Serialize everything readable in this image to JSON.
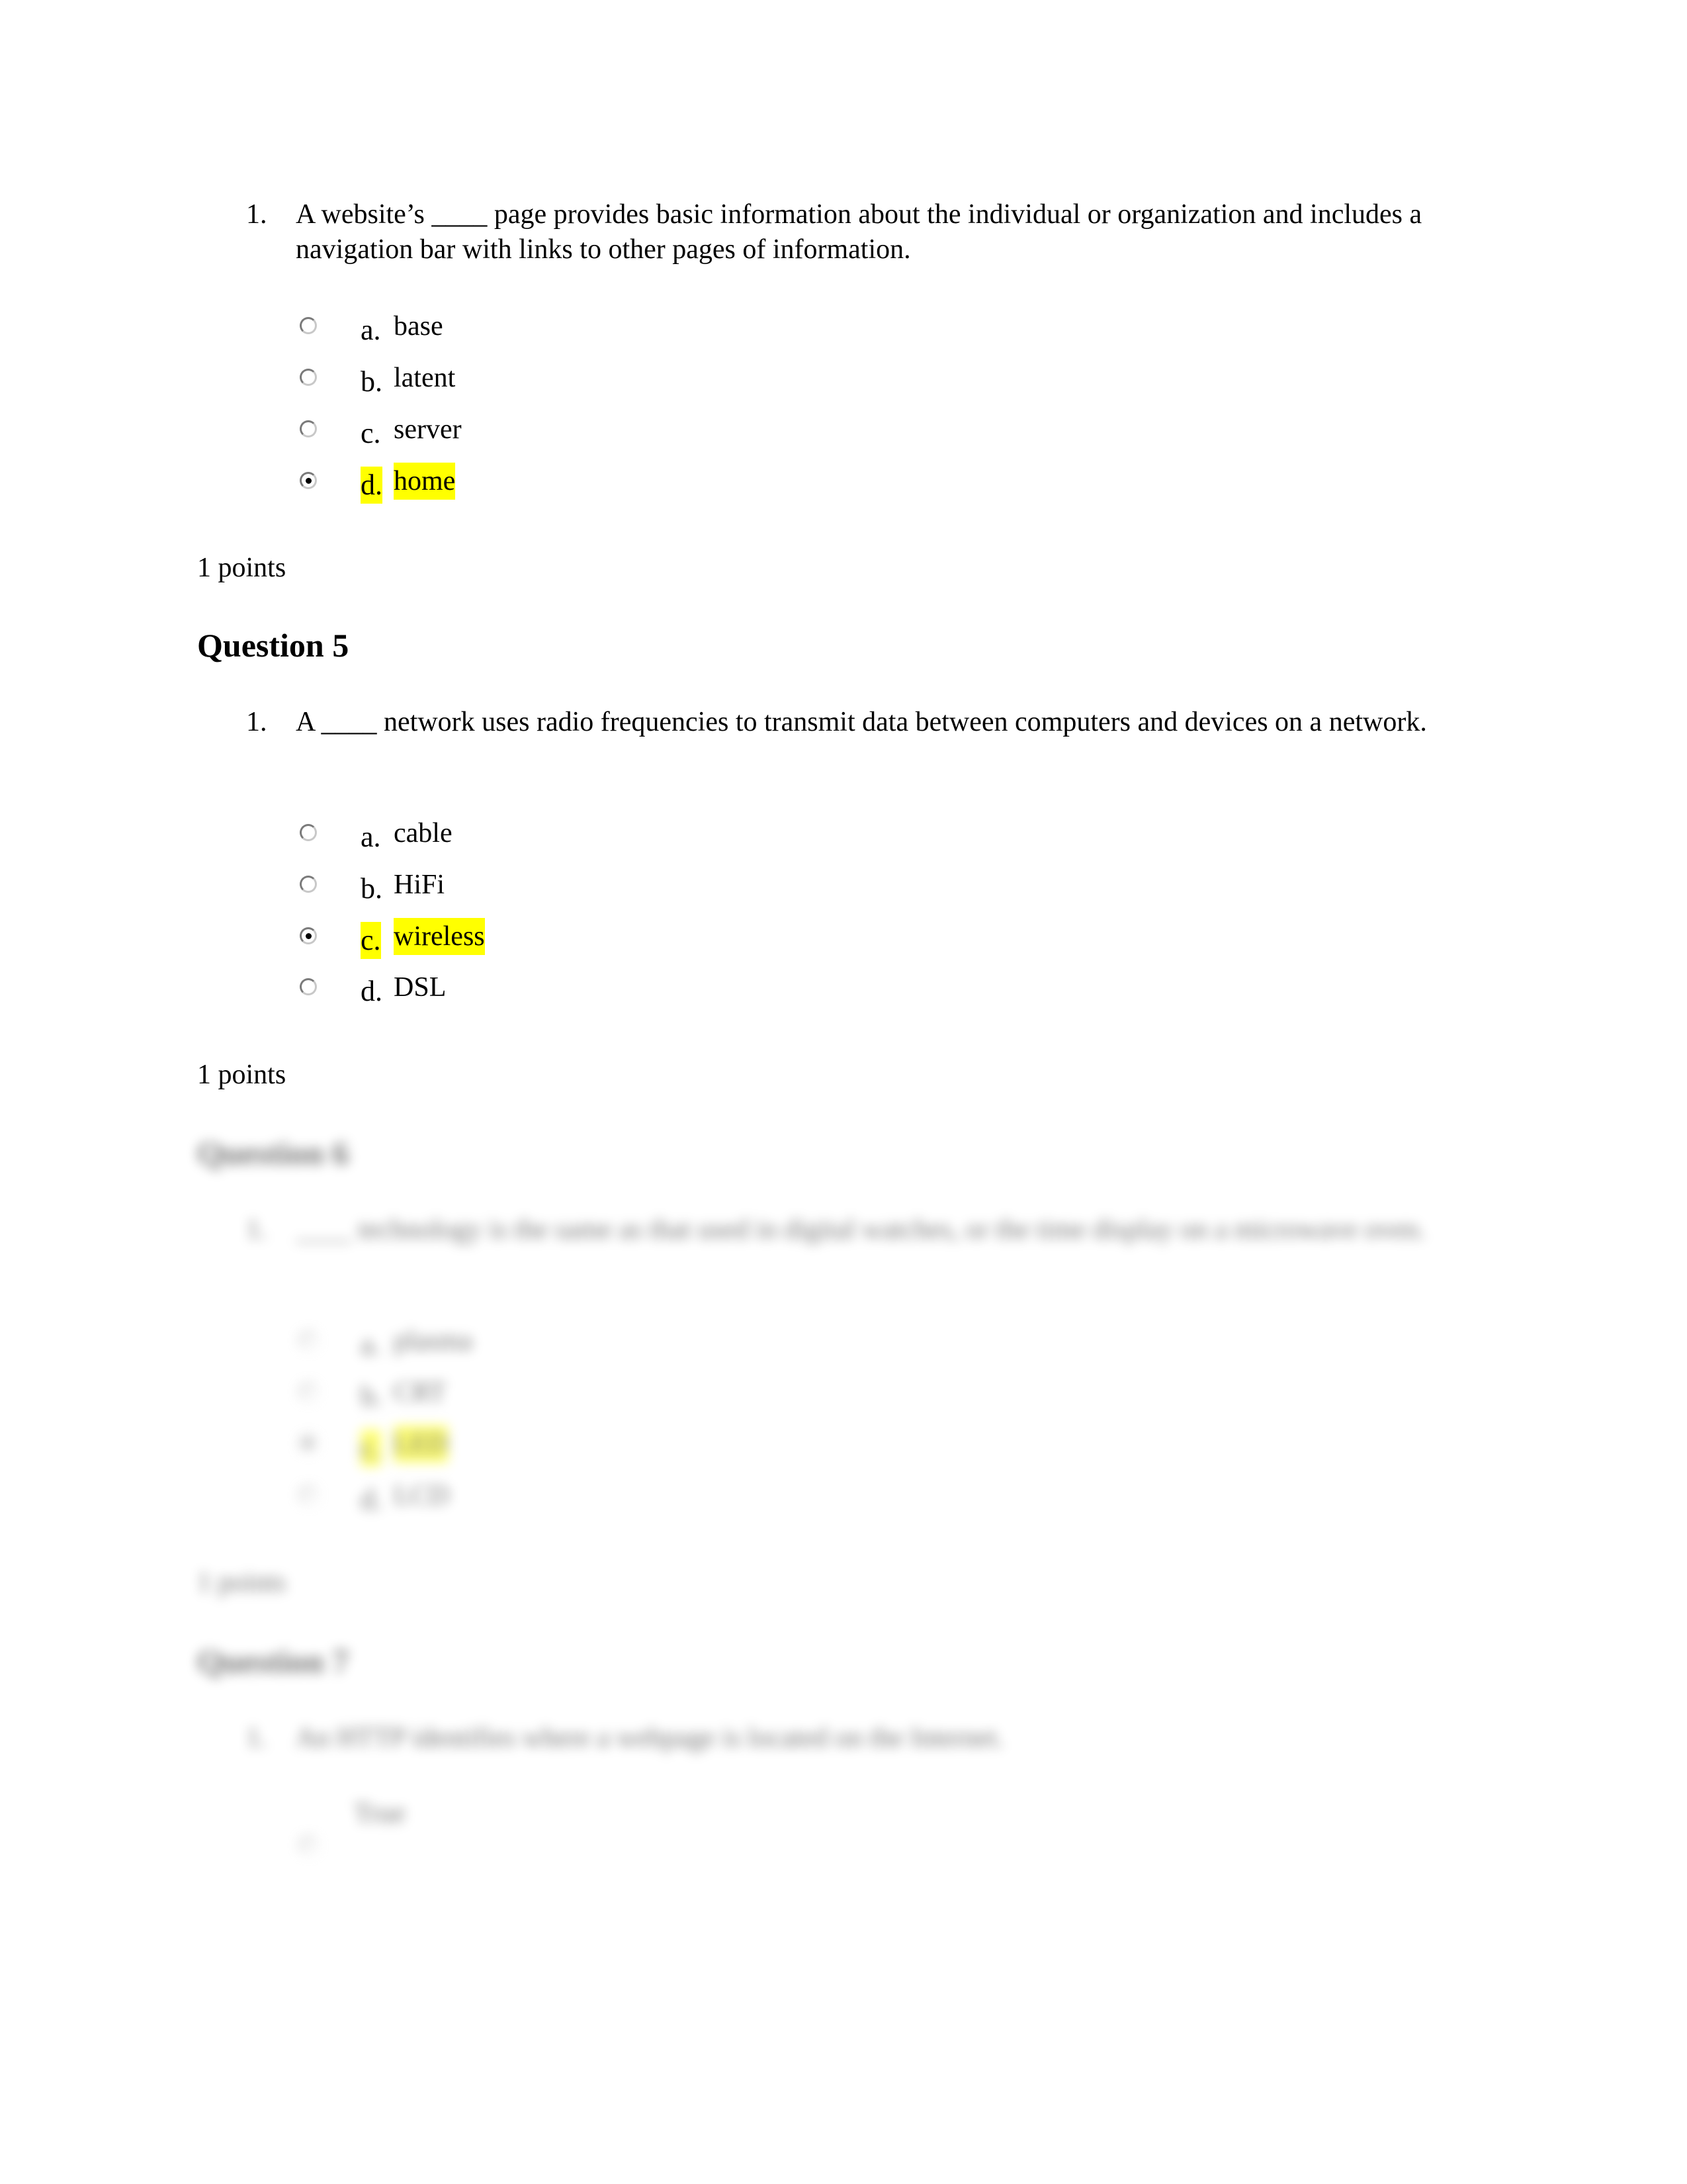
{
  "questions": [
    {
      "heading": "",
      "number": "1.",
      "text": "A website’s ____ page provides basic information about the individual or organization and includes a navigation bar with links to other pages of information.",
      "options": [
        {
          "letter": "a.",
          "text": "base",
          "selected": false
        },
        {
          "letter": "b.",
          "text": "latent",
          "selected": false
        },
        {
          "letter": "c.",
          "text": "server",
          "selected": false
        },
        {
          "letter": "d.",
          "text": "home",
          "selected": true
        }
      ],
      "points": "1 points"
    },
    {
      "heading": "Question 5",
      "number": "1.",
      "text": "A ____ network uses radio frequencies to transmit data between computers and devices on a network.",
      "options": [
        {
          "letter": "a.",
          "text": "cable",
          "selected": false
        },
        {
          "letter": "b.",
          "text": "HiFi",
          "selected": false
        },
        {
          "letter": "c.",
          "text": "wireless",
          "selected": true
        },
        {
          "letter": "d.",
          "text": "DSL",
          "selected": false
        }
      ],
      "points": "1 points"
    },
    {
      "heading": "Question 6",
      "number": "1.",
      "text": "____ technology is the same as that used in digital watches, or the time display on a microwave oven.",
      "options": [
        {
          "letter": "a.",
          "text": "plasma",
          "selected": false
        },
        {
          "letter": "b.",
          "text": "CRT",
          "selected": false
        },
        {
          "letter": "c.",
          "text": "LED",
          "selected": true
        },
        {
          "letter": "d.",
          "text": "LCD",
          "selected": false
        }
      ],
      "points": "1 points"
    },
    {
      "heading": "Question 7",
      "number": "1.",
      "text": "An HTTP identifies where a webpage is located on the Internet.",
      "options": [
        {
          "letter": "",
          "text": "True",
          "selected": false
        }
      ]
    }
  ],
  "colors": {
    "highlight": "#ffff00",
    "text": "#000000"
  }
}
